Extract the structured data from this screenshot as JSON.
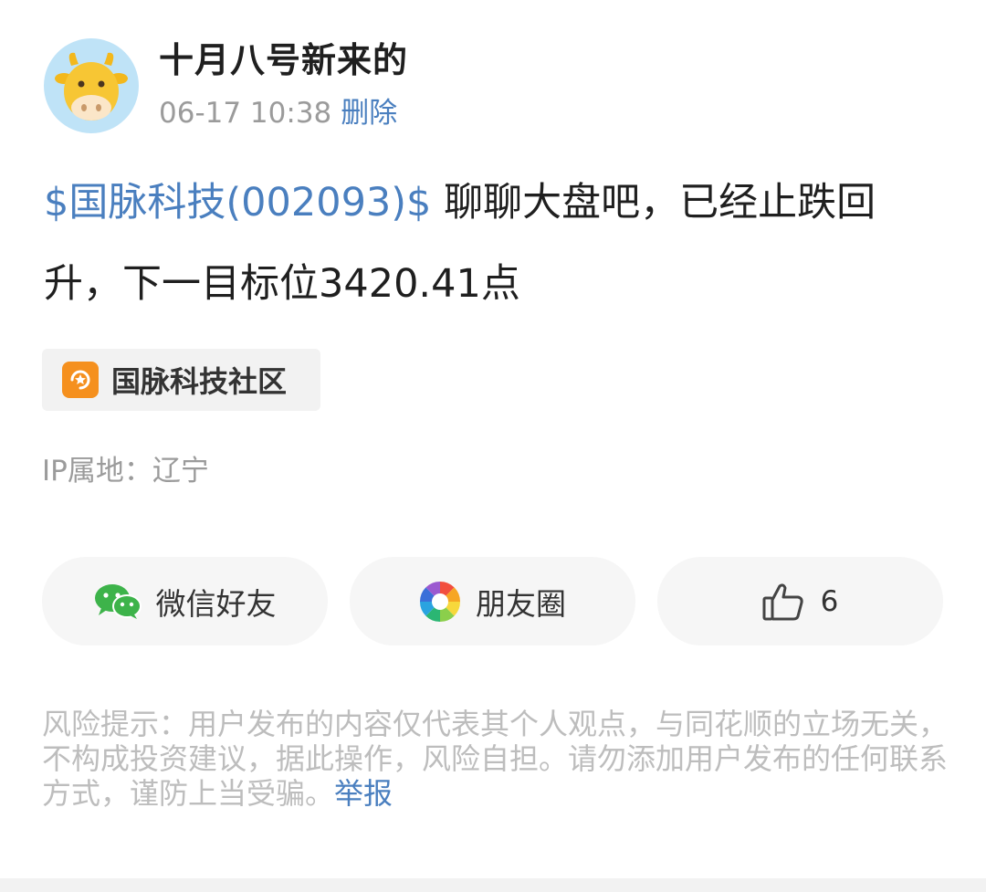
{
  "header": {
    "username": "十月八号新来的",
    "time": "06-17 10:38",
    "delete_label": "删除",
    "avatar_icon": "cow-avatar-icon"
  },
  "post": {
    "stock_link": "$国脉科技(002093)$",
    "text": " 聊聊大盘吧，已经止跌回升，下一目标位3420.41点"
  },
  "community": {
    "label": "国脉科技社区",
    "icon": "community-icon",
    "icon_color": "#f5901e"
  },
  "ip_location": "IP属地：辽宁",
  "share_bar": {
    "wechat_label": "微信好友",
    "moments_label": "朋友圈",
    "like_count": "6"
  },
  "disclaimer": {
    "text": "风险提示：用户发布的内容仅代表其个人观点，与同花顺的立场无关，不构成投资建议，据此操作，风险自担。请勿添加用户发布的任何联系方式，谨防上当受骗。",
    "report_label": "举报"
  },
  "colors": {
    "link": "#4a7fbf",
    "muted": "#9b9b9b",
    "wechat_green": "#3db34a"
  }
}
